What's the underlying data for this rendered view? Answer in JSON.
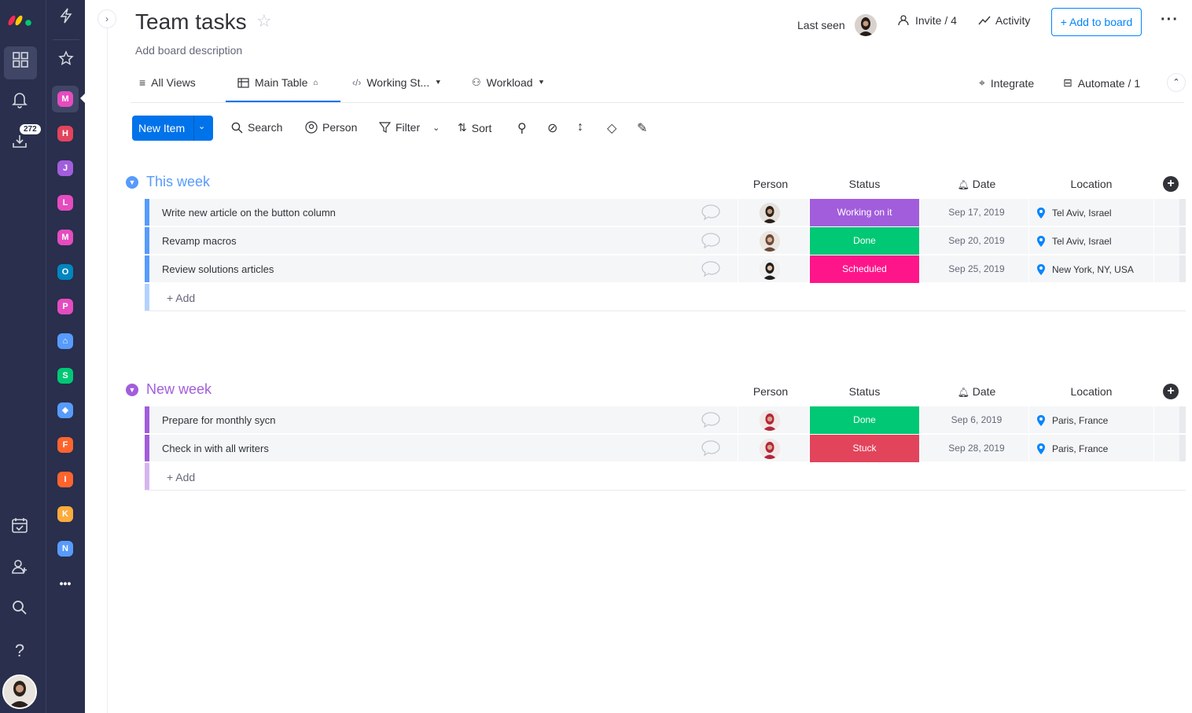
{
  "sidebar": {
    "inbox_badge": "272",
    "workspaces": [
      {
        "letter": "M",
        "color": "#e44cbf"
      },
      {
        "letter": "H",
        "color": "#e2445c"
      },
      {
        "letter": "J",
        "color": "#a25ddc"
      },
      {
        "letter": "L",
        "color": "#e44cbf"
      },
      {
        "letter": "M",
        "color": "#e44cbf"
      },
      {
        "letter": "O",
        "color": "#0086c0"
      },
      {
        "letter": "P",
        "color": "#e44cbf"
      },
      {
        "letter": "⌂",
        "color": "#579bfc"
      },
      {
        "letter": "S",
        "color": "#00c875"
      },
      {
        "letter": "◆",
        "color": "#579bfc"
      },
      {
        "letter": "F",
        "color": "#ff642e"
      },
      {
        "letter": "I",
        "color": "#ff642e"
      },
      {
        "letter": "K",
        "color": "#fdab3d"
      },
      {
        "letter": "N",
        "color": "#579bfc"
      }
    ],
    "more": "•••",
    "help": "?"
  },
  "header": {
    "title": "Team tasks",
    "description": "Add board description",
    "last_seen": "Last seen",
    "invite": "Invite / 4",
    "activity": "Activity",
    "add_to_board": "+ Add to board"
  },
  "tabs": {
    "all_views": "All Views",
    "main_table": "Main Table",
    "working": "Working St...",
    "workload": "Workload",
    "integrate": "Integrate",
    "automate": "Automate / 1"
  },
  "toolbar": {
    "new_item": "New Item",
    "search": "Search",
    "person": "Person",
    "filter": "Filter",
    "sort": "Sort"
  },
  "columns": {
    "person": "Person",
    "status": "Status",
    "date": "Date",
    "location": "Location"
  },
  "groups": [
    {
      "title": "This week",
      "color": "#579bfc",
      "add_label": "+ Add",
      "rows": [
        {
          "name": "Write new article on the button column",
          "status": "Working on it",
          "status_color": "#a25ddc",
          "date": "Sep 17, 2019",
          "location": "Tel Aviv, Israel"
        },
        {
          "name": "Revamp macros",
          "status": "Done",
          "status_color": "#00c875",
          "date": "Sep 20, 2019",
          "location": "Tel Aviv, Israel"
        },
        {
          "name": "Review solutions articles",
          "status": "Scheduled",
          "status_color": "#ff158a",
          "date": "Sep 25, 2019",
          "location": "New York, NY, USA"
        }
      ]
    },
    {
      "title": "New week",
      "color": "#a25ddc",
      "add_label": "+ Add",
      "rows": [
        {
          "name": "Prepare for monthly sycn",
          "status": "Done",
          "status_color": "#00c875",
          "date": "Sep 6, 2019",
          "location": "Paris, France"
        },
        {
          "name": "Check in with all writers",
          "status": "Stuck",
          "status_color": "#e2445c",
          "date": "Sep 28, 2019",
          "location": "Paris, France"
        }
      ]
    }
  ]
}
